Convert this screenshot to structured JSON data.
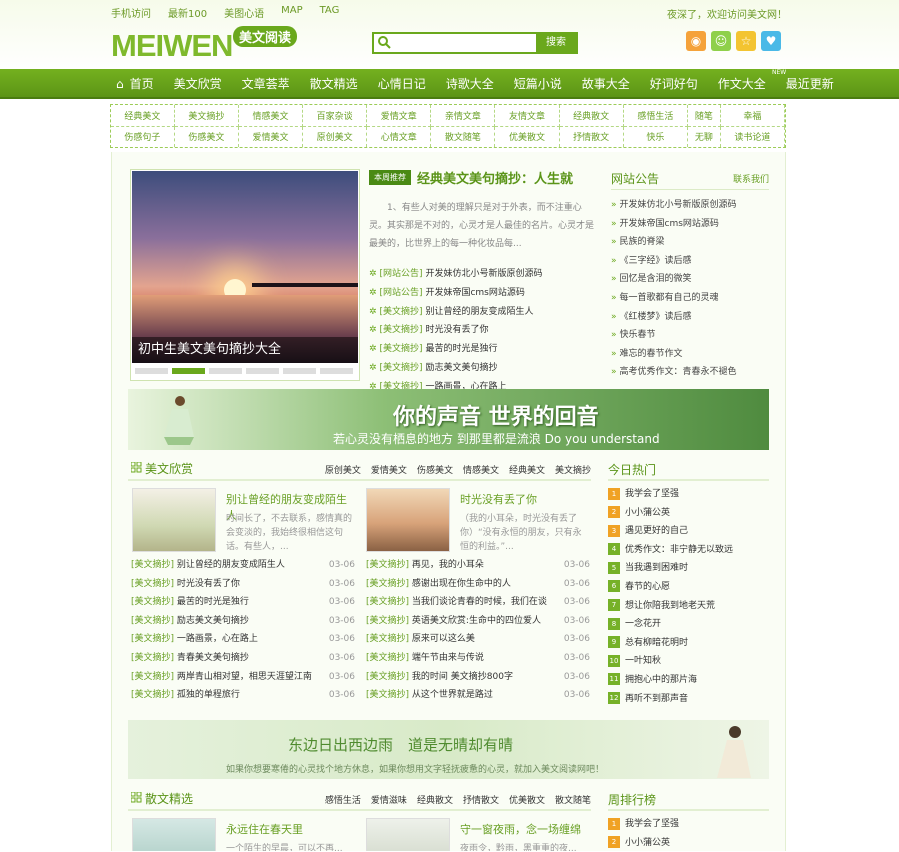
{
  "top": {
    "links": [
      "手机访问",
      "最新100",
      "美图心语",
      "MAP",
      "TAG"
    ],
    "welcome": "夜深了，欢迎访问美文网！",
    "logo_en": "MEIWEN",
    "logo_cn": "美文阅读",
    "search_placeholder": "",
    "search_button": "搜索"
  },
  "social": [
    {
      "icon": "weibo-icon",
      "color": "#f5a23a"
    },
    {
      "icon": "chat-icon",
      "color": "#8fd04a"
    },
    {
      "icon": "star-icon",
      "color": "#f3c431"
    },
    {
      "icon": "heart-icon",
      "color": "#4ab9e7"
    }
  ],
  "nav": {
    "items": [
      "首页",
      "美文欣赏",
      "文章荟萃",
      "散文精选",
      "心情日记",
      "诗歌大全",
      "短篇小说",
      "故事大全",
      "好词好句",
      "作文大全",
      "最近更新"
    ],
    "new_tag": "NEW"
  },
  "cats": {
    "row1": [
      "经典美文",
      "美文摘抄",
      "情感美文",
      "百家杂谈",
      "爱情文章",
      "亲情文章",
      "友情文章",
      "经典散文",
      "感悟生活",
      "随笔",
      "幸福"
    ],
    "row2": [
      "伤感句子",
      "伤感美文",
      "爱情美文",
      "原创美文",
      "心情文章",
      "散文随笔",
      "优美散文",
      "抒情散文",
      "快乐",
      "无聊",
      "读书论道"
    ]
  },
  "hero": {
    "caption": "初中生美文美句摘抄大全"
  },
  "featured": {
    "tag": "本周推荐",
    "title": "经典美文美句摘抄：人生就",
    "desc": "1、有些人对美的理解只是对于外表，而不注重心灵。其实那是不对的，心灵才是人最佳的名片。心灵才是最美的，比世界上的每一种化妆品每...",
    "items": [
      {
        "cat": "[网站公告]",
        "title": "开发妹仿北小号新版原创源码"
      },
      {
        "cat": "[网站公告]",
        "title": "开发妹帝国cms网站源码"
      },
      {
        "cat": "[美文摘抄]",
        "title": "别让曾经的朋友变成陌生人"
      },
      {
        "cat": "[美文摘抄]",
        "title": "时光没有丢了你"
      },
      {
        "cat": "[美文摘抄]",
        "title": "最苦的时光是独行"
      },
      {
        "cat": "[美文摘抄]",
        "title": "励志美文美句摘抄"
      },
      {
        "cat": "[美文摘抄]",
        "title": "一路画景，心在路上"
      }
    ]
  },
  "notice": {
    "title": "网站公告",
    "more": "联系我们",
    "items": [
      "开发妹仿北小号新版原创源码",
      "开发妹帝国cms网站源码",
      "民族的脊梁",
      "《三字经》读后感",
      "回忆是含泪的微笑",
      "每一首歌都有自己的灵魂",
      "《红楼梦》读后感",
      "快乐春节",
      "难忘的春节作文",
      "高考优秀作文：青春永不褪色"
    ]
  },
  "banner1": {
    "line1": "你的声音 世界的回音",
    "line2": "若心灵没有栖息的地方 到那里都是流浪 Do you understand"
  },
  "meiwen": {
    "title": "美文欣赏",
    "subs": [
      "原创美文",
      "爱情美文",
      "伤感美文",
      "情感美文",
      "经典美文",
      "美文摘抄"
    ],
    "cards": [
      {
        "title": "别让曾经的朋友变成陌生人",
        "desc": "时间长了，不去联系，感情真的会变淡的，我始终很相信这句话。有些人，..."
      },
      {
        "title": "时光没有丢了你",
        "desc": "（我的小耳朵，时光没有丢了你）“没有永恒的朋友，只有永恒的利益。”..."
      }
    ],
    "left": [
      {
        "cat": "[美文摘抄]",
        "title": "别让曾经的朋友变成陌生人",
        "date": "03-06"
      },
      {
        "cat": "[美文摘抄]",
        "title": "时光没有丢了你",
        "date": "03-06"
      },
      {
        "cat": "[美文摘抄]",
        "title": "最苦的时光是独行",
        "date": "03-06"
      },
      {
        "cat": "[美文摘抄]",
        "title": "励志美文美句摘抄",
        "date": "03-06"
      },
      {
        "cat": "[美文摘抄]",
        "title": "一路画景，心在路上",
        "date": "03-06"
      },
      {
        "cat": "[美文摘抄]",
        "title": "青春美文美句摘抄",
        "date": "03-06"
      },
      {
        "cat": "[美文摘抄]",
        "title": "两岸青山相对望，相思天涯望江南",
        "date": "03-06"
      },
      {
        "cat": "[美文摘抄]",
        "title": "孤独的单程旅行",
        "date": "03-06"
      }
    ],
    "right": [
      {
        "cat": "[美文摘抄]",
        "title": "再见，我的小耳朵",
        "date": "03-06"
      },
      {
        "cat": "[美文摘抄]",
        "title": "感谢出现在你生命中的人",
        "date": "03-06"
      },
      {
        "cat": "[美文摘抄]",
        "title": "当我们谈论青春的时候，我们在谈",
        "date": "03-06"
      },
      {
        "cat": "[美文摘抄]",
        "title": "英语美文欣赏:生命中的四位爱人",
        "date": "03-06"
      },
      {
        "cat": "[美文摘抄]",
        "title": "原来可以这么美",
        "date": "03-06"
      },
      {
        "cat": "[美文摘抄]",
        "title": "端午节由来与传说",
        "date": "03-06"
      },
      {
        "cat": "[美文摘抄]",
        "title": "我的时间 美文摘抄800字",
        "date": "03-06"
      },
      {
        "cat": "[美文摘抄]",
        "title": "从这个世界就是路过",
        "date": "03-06"
      }
    ]
  },
  "hot": {
    "title": "今日热门",
    "items": [
      "我学会了坚强",
      "小小蒲公英",
      "遇见更好的自己",
      "优秀作文：非宁静无以致远",
      "当我遇到困难时",
      "春节的心愿",
      "想让你陪我到地老天荒",
      "一念花开",
      "总有柳暗花明时",
      "一叶知秋",
      "拥抱心中的那片海",
      "再听不到那声音"
    ]
  },
  "banner2": {
    "line1": "东边日出西边雨　道是无晴却有晴",
    "line2": "如果你想要寒倦的心灵找个地方休息，如果你想用文字轻抚疲惫的心灵，就加入美文阅读网吧！"
  },
  "sanwen": {
    "title": "散文精选",
    "subs": [
      "感悟生活",
      "爱情滋味",
      "经典散文",
      "抒情散文",
      "优美散文",
      "散文随笔"
    ],
    "cards": [
      {
        "title": "永远住在春天里",
        "desc": "一个陌生的早晨，可以不再..."
      },
      {
        "title": "守一窗夜雨，念一场缠绵",
        "desc": "夜雨令，黔雨，黑重重的夜..."
      }
    ]
  },
  "rank": {
    "title": "周排行榜",
    "items": [
      "我学会了坚强",
      "小小蒲公英"
    ]
  }
}
